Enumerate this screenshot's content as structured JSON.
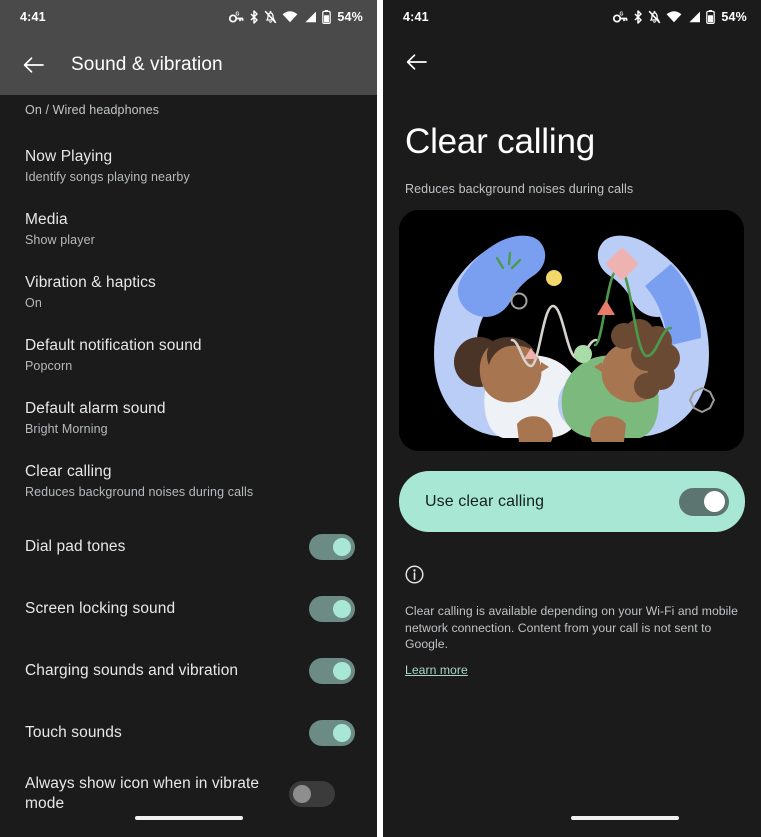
{
  "status_bar": {
    "time": "4:41",
    "battery_percent": "54%",
    "icons": [
      "vpn-key-icon",
      "bluetooth-icon",
      "notifications-off-icon",
      "wifi-icon",
      "cellular-signal-icon",
      "battery-icon"
    ]
  },
  "colors": {
    "accent_mint": "#a9e7d5",
    "switch_on_track": "#6d8b85",
    "switch_off_track": "#3b3b3b",
    "switch_off_thumb": "#8e8e8e",
    "card_switch_track": "#5d7570",
    "background": "#1b1b1b",
    "appbar": "#4a4a4a",
    "link": "#a9d7c9"
  },
  "left_screen": {
    "back_label": "Back",
    "title": "Sound & vibration",
    "partial_row_subtitle": "On / Wired headphones",
    "items": [
      {
        "title": "Now Playing",
        "subtitle": "Identify songs playing nearby"
      },
      {
        "title": "Media",
        "subtitle": "Show player"
      },
      {
        "title": "Vibration & haptics",
        "subtitle": "On"
      },
      {
        "title": "Default notification sound",
        "subtitle": "Popcorn"
      },
      {
        "title": "Default alarm sound",
        "subtitle": "Bright Morning"
      },
      {
        "title": "Clear calling",
        "subtitle": "Reduces background noises during calls"
      }
    ],
    "toggles": [
      {
        "title": "Dial pad tones",
        "on": true
      },
      {
        "title": "Screen locking sound",
        "on": true
      },
      {
        "title": "Charging sounds and vibration",
        "on": true
      },
      {
        "title": "Touch sounds",
        "on": true
      },
      {
        "title": "Always show icon when in vibrate mode",
        "on": false
      }
    ]
  },
  "right_screen": {
    "back_label": "Back",
    "title": "Clear calling",
    "subtitle": "Reduces background noises during calls",
    "illustration_name": "clear-calling-illustration",
    "card": {
      "label": "Use clear calling",
      "on": true
    },
    "info_icon": "info-icon",
    "info_text": "Clear calling is available depending on your Wi-Fi and mobile network connection. Content from your call is not sent to Google.",
    "learn_more": "Learn more"
  }
}
